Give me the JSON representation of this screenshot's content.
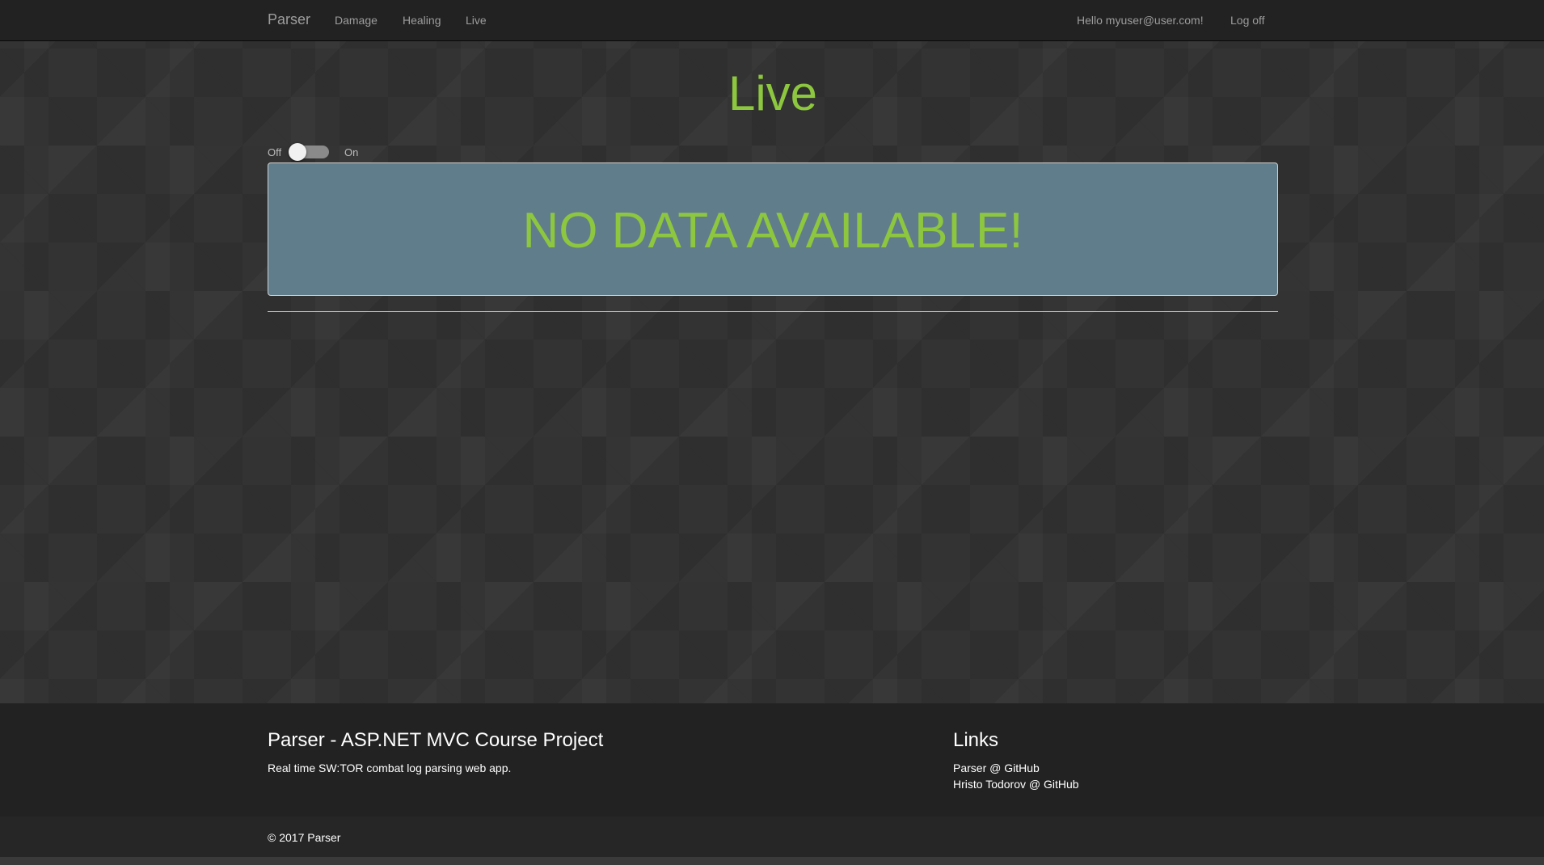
{
  "navbar": {
    "brand": "Parser",
    "links": [
      "Damage",
      "Healing",
      "Live"
    ],
    "greeting": "Hello myuser@user.com!",
    "logoff": "Log off"
  },
  "main": {
    "title": "Live",
    "toggle": {
      "off_label": "Off",
      "on_label": "On",
      "state": "off"
    },
    "message": "NO DATA AVAILABLE!"
  },
  "footer": {
    "project_title": "Parser - ASP.NET MVC Course Project",
    "description": "Real time SW:TOR combat log parsing web app.",
    "links_title": "Links",
    "links": [
      "Parser @ GitHub",
      "Hristo Todorov @ GitHub"
    ],
    "copyright": "© 2017 Parser"
  },
  "colors": {
    "accent": "#8dc63f",
    "navbar_bg": "#222222",
    "panel_bg": "#607d8b",
    "page_bg": "#333333"
  }
}
